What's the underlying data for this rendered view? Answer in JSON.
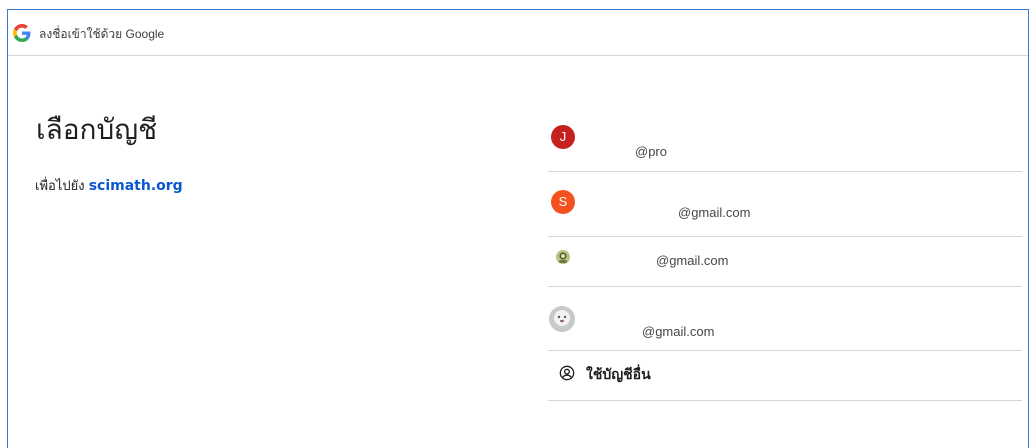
{
  "header": {
    "title": "ลงชื่อเข้าใช้ด้วย Google",
    "logo_icon": "google-g-icon"
  },
  "main": {
    "title": "เลือกบัญชี",
    "subtitle_prefix": "เพื่อไปยัง",
    "site": "scimath.org"
  },
  "accounts": [
    {
      "avatar_letter": "J",
      "avatar_color": "#c5221f",
      "email": "@pro"
    },
    {
      "avatar_letter": "S",
      "avatar_color": "#f4511e",
      "email": "@gmail.com"
    },
    {
      "avatar_letter": "",
      "avatar_color": "#8a9a5b",
      "email": "@gmail.com"
    },
    {
      "avatar_letter": "",
      "avatar_color": "#d9d9d9",
      "email": "@gmail.com"
    }
  ],
  "use_other": {
    "label": "ใช้บัญชีอื่น",
    "icon": "account-circle-icon"
  },
  "colors": {
    "link": "#0b57d0",
    "frame_border": "#3a78d8"
  }
}
